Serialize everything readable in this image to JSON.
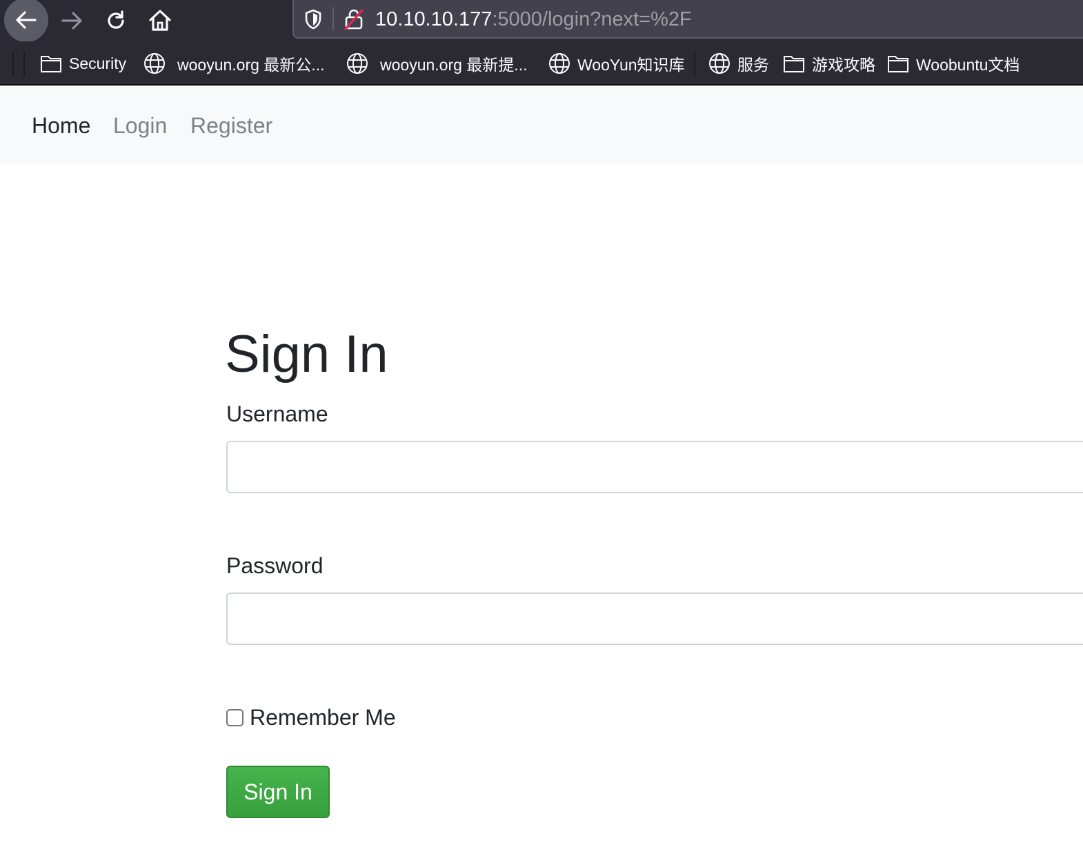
{
  "browser": {
    "url_host": "10.10.10.177",
    "url_rest": ":5000/login?next=%2F",
    "bookmarks": [
      {
        "label": "Security",
        "icon": "folder-icon"
      },
      {
        "label": "wooyun.org 最新公...",
        "icon": "globe-icon"
      },
      {
        "label": "wooyun.org 最新提...",
        "icon": "globe-icon"
      },
      {
        "label": "WooYun知识库",
        "icon": "globe-icon"
      },
      {
        "label": "服务",
        "icon": "globe-icon"
      },
      {
        "label": "游戏攻略",
        "icon": "folder-icon"
      },
      {
        "label": "Woobuntu文档",
        "icon": "folder-icon"
      }
    ]
  },
  "navbar": {
    "links": [
      {
        "label": "Home",
        "active": true
      },
      {
        "label": "Login",
        "active": false
      },
      {
        "label": "Register",
        "active": false
      }
    ]
  },
  "form": {
    "title": "Sign In",
    "username_label": "Username",
    "username_value": "",
    "password_label": "Password",
    "password_value": "",
    "remember_label": "Remember Me",
    "remember_checked": false,
    "submit_label": "Sign In"
  },
  "colors": {
    "chrome_bg": "#2b2a33",
    "urlbar_bg": "#42414d",
    "navbar_bg": "#f8f9fa",
    "button_green": "#3ea845"
  }
}
